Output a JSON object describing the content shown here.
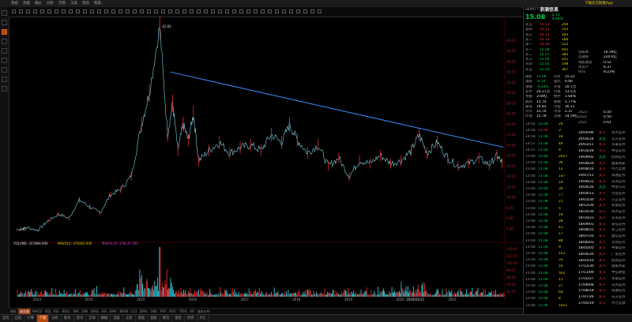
{
  "app": {
    "stock_code": "000977",
    "stock_name": "浪潮信息",
    "last_price": "15.08",
    "change": "-0.70",
    "change_pct": "-4.44%",
    "mode_label": "日线",
    "promo": "下载东方财富App",
    "colors": {
      "up": "#ff3b3b",
      "down": "#00d24c",
      "trend": "#3a8dff",
      "accent": "#b5470f",
      "volume": "#32c8d8"
    }
  },
  "menus": [
    "系统",
    "功能",
    "报价",
    "分析",
    "交易",
    "工具",
    "资讯",
    "帮助"
  ],
  "left_icons": [
    "home-icon",
    "quote-icon",
    "chart-icon",
    "news-icon",
    "trade-icon",
    "select-icon",
    "data-icon",
    "tool-icon",
    "more-icon"
  ],
  "chart_data": {
    "type": "line",
    "annotations": {
      "high_label": "42.83",
      "low_label": "3.65"
    },
    "y_ticks": [
      40,
      38,
      36,
      34,
      32,
      30,
      28,
      26,
      24,
      22,
      20,
      18,
      16,
      14,
      12,
      10,
      8,
      6,
      4
    ],
    "x_ticks": [
      "2013",
      "2014",
      "2015",
      "2016",
      "2017",
      "2018",
      "2019",
      "2020",
      "2020/03/11",
      "2021"
    ],
    "price_series": [
      {
        "x": 2012.6,
        "y": 3.8
      },
      {
        "x": 2012.8,
        "y": 4.2
      },
      {
        "x": 2013.0,
        "y": 3.7
      },
      {
        "x": 2013.2,
        "y": 5.5
      },
      {
        "x": 2013.4,
        "y": 6.8
      },
      {
        "x": 2013.6,
        "y": 6.0
      },
      {
        "x": 2013.8,
        "y": 9.5
      },
      {
        "x": 2014.0,
        "y": 8.2
      },
      {
        "x": 2014.2,
        "y": 7.0
      },
      {
        "x": 2014.4,
        "y": 10.5
      },
      {
        "x": 2014.6,
        "y": 11.5
      },
      {
        "x": 2014.8,
        "y": 14.0
      },
      {
        "x": 2015.0,
        "y": 24.0
      },
      {
        "x": 2015.15,
        "y": 30.0
      },
      {
        "x": 2015.35,
        "y": 42.8
      },
      {
        "x": 2015.5,
        "y": 22.0
      },
      {
        "x": 2015.6,
        "y": 28.0
      },
      {
        "x": 2015.7,
        "y": 19.0
      },
      {
        "x": 2015.8,
        "y": 24.0
      },
      {
        "x": 2015.9,
        "y": 21.0
      },
      {
        "x": 2016.0,
        "y": 26.0
      },
      {
        "x": 2016.1,
        "y": 17.0
      },
      {
        "x": 2016.3,
        "y": 19.0
      },
      {
        "x": 2016.5,
        "y": 20.5
      },
      {
        "x": 2016.7,
        "y": 18.5
      },
      {
        "x": 2016.9,
        "y": 19.5
      },
      {
        "x": 2017.1,
        "y": 20.0
      },
      {
        "x": 2017.3,
        "y": 19.0
      },
      {
        "x": 2017.5,
        "y": 22.0
      },
      {
        "x": 2017.7,
        "y": 20.5
      },
      {
        "x": 2017.85,
        "y": 24.0
      },
      {
        "x": 2018.0,
        "y": 21.0
      },
      {
        "x": 2018.2,
        "y": 18.5
      },
      {
        "x": 2018.4,
        "y": 20.0
      },
      {
        "x": 2018.6,
        "y": 16.0
      },
      {
        "x": 2018.8,
        "y": 17.5
      },
      {
        "x": 2019.0,
        "y": 14.0
      },
      {
        "x": 2019.2,
        "y": 17.0
      },
      {
        "x": 2019.4,
        "y": 16.5
      },
      {
        "x": 2019.6,
        "y": 18.0
      },
      {
        "x": 2019.8,
        "y": 16.5
      },
      {
        "x": 2020.0,
        "y": 17.0
      },
      {
        "x": 2020.2,
        "y": 19.0
      },
      {
        "x": 2020.35,
        "y": 22.0
      },
      {
        "x": 2020.5,
        "y": 18.5
      },
      {
        "x": 2020.7,
        "y": 20.5
      },
      {
        "x": 2020.9,
        "y": 17.5
      },
      {
        "x": 2021.1,
        "y": 16.0
      },
      {
        "x": 2021.3,
        "y": 16.5
      },
      {
        "x": 2021.5,
        "y": 17.5
      },
      {
        "x": 2021.7,
        "y": 16.2
      },
      {
        "x": 2021.85,
        "y": 18.0
      },
      {
        "x": 2021.95,
        "y": 16.5
      }
    ],
    "trend_line": {
      "from": {
        "x": 2015.55,
        "y": 34.0
      },
      "to": {
        "x": 2021.97,
        "y": 19.6
      }
    },
    "volume_labels": [
      "150.00",
      "120.00",
      "100.00",
      "80.00",
      "60.00",
      "40.00",
      "20.00"
    ],
    "volume_header": [
      "VOLUME: 247889.000",
      "MAVOL5: 379362.000",
      "MAVOL10: 378137.000"
    ],
    "ma_header": "MA5  MA10  MA20",
    "grid": false
  },
  "indicator_tabs": [
    "指标",
    "成交量",
    "MACD",
    "KDJ",
    "RSI",
    "BOLL",
    "WR",
    "DMI",
    "BIAS",
    "ASI",
    "EMV",
    "BRAR",
    "CCI",
    "DMA",
    "OBV",
    "PSY",
    "ROC",
    "TRIX",
    "VR",
    "成本分布"
  ],
  "bottom_tabs": [
    "首页",
    "自选",
    "行情",
    "个股",
    "分析",
    "板块",
    "资讯",
    "全球",
    "数据",
    "选股",
    "交易",
    "港股",
    "美股",
    "期货",
    "基金",
    "债券",
    "外汇"
  ],
  "quote_rows": [
    {
      "label": "卖五",
      "price": "15.13",
      "vol": "200",
      "color": "red"
    },
    {
      "label": "卖四",
      "price": "15.12",
      "vol": "252",
      "color": "red"
    },
    {
      "label": "卖三",
      "price": "15.11",
      "vol": "183",
      "color": "red"
    },
    {
      "label": "卖二",
      "price": "15.10",
      "vol": "166",
      "color": "red"
    },
    {
      "label": "卖一",
      "price": "15.09",
      "vol": "523",
      "color": "red"
    },
    {
      "label": "买一",
      "price": "15.08",
      "vol": "491",
      "color": "green"
    },
    {
      "label": "买二",
      "price": "15.07",
      "vol": "385",
      "color": "green"
    },
    {
      "label": "买三",
      "price": "15.06",
      "vol": "241",
      "color": "green"
    },
    {
      "label": "买四",
      "price": "15.05",
      "vol": "198",
      "color": "green"
    },
    {
      "label": "买五",
      "price": "15.04",
      "vol": "367",
      "color": "green"
    }
  ],
  "stats": [
    {
      "k": "最新",
      "v": "15.08",
      "k2": "均价",
      "v2": "15.22"
    },
    {
      "k": "涨跌",
      "v": "-0.70",
      "k2": "量比",
      "v2": "0.66"
    },
    {
      "k": "涨幅",
      "v": "-4.44%",
      "k2": "外盘",
      "v2": "10.7万"
    },
    {
      "k": "总手",
      "v": "24.27万",
      "k2": "内盘",
      "v2": "13.5万"
    },
    {
      "k": "金额",
      "v": "3.69亿",
      "k2": "换手",
      "v2": "1.64%"
    },
    {
      "k": "最高",
      "v": "15.74",
      "k2": "振幅",
      "v2": "5.77%"
    },
    {
      "k": "最低",
      "v": "14.83",
      "k2": "市盈",
      "v2": "26.11"
    },
    {
      "k": "今开",
      "v": "15.70",
      "k2": "市净",
      "v2": "2.37"
    },
    {
      "k": "昨收",
      "v": "15.78",
      "k2": "流通",
      "v2": "14.59亿"
    }
  ],
  "info_box": [
    {
      "k": "总股本",
      "v": "14.59亿"
    },
    {
      "k": "流通值",
      "v": "220.0亿"
    },
    {
      "k": "每股收益",
      "v": "0.52"
    },
    {
      "k": "净资产",
      "v": "6.37"
    },
    {
      "k": "ROE",
      "v": "8.23%"
    }
  ],
  "ticks": [
    {
      "t": "14:55",
      "p": "15.08",
      "v": "24",
      "c": "green"
    },
    {
      "t": "14:56",
      "p": "15.09",
      "v": "3",
      "c": "red"
    },
    {
      "t": "14:56",
      "p": "15.08",
      "v": "18",
      "c": "green"
    },
    {
      "t": "14:57",
      "p": "15.08",
      "v": "49",
      "c": "green"
    },
    {
      "t": "14:57",
      "p": "15.08",
      "v": "9",
      "c": "green"
    },
    {
      "t": "15:00",
      "p": "15.08",
      "v": "2457",
      "c": "green"
    },
    {
      "t": "15:00",
      "p": "15.08",
      "v": "36",
      "c": "green"
    },
    {
      "t": "15:00",
      "p": "15.08",
      "v": "12",
      "c": "green"
    },
    {
      "t": "15:00",
      "p": "15.08",
      "v": "107",
      "c": "green"
    },
    {
      "t": "15:00",
      "p": "15.08",
      "v": "14",
      "c": "green"
    },
    {
      "t": "15:00",
      "p": "15.08",
      "v": "30",
      "c": "green"
    },
    {
      "t": "15:00",
      "p": "15.08",
      "v": "77",
      "c": "green"
    },
    {
      "t": "15:00",
      "p": "15.08",
      "v": "21",
      "c": "green"
    },
    {
      "t": "15:00",
      "p": "15.08",
      "v": "5",
      "c": "green"
    },
    {
      "t": "15:00",
      "p": "15.08",
      "v": "19",
      "c": "green"
    },
    {
      "t": "15:00",
      "p": "15.08",
      "v": "28",
      "c": "green"
    },
    {
      "t": "15:00",
      "p": "15.08",
      "v": "41",
      "c": "green"
    },
    {
      "t": "15:00",
      "p": "15.08",
      "v": "17",
      "c": "green"
    },
    {
      "t": "15:00",
      "p": "15.08",
      "v": "88",
      "c": "green"
    },
    {
      "t": "15:00",
      "p": "15.08",
      "v": "9",
      "c": "green"
    },
    {
      "t": "15:00",
      "p": "15.08",
      "v": "152",
      "c": "green"
    },
    {
      "t": "15:00",
      "p": "15.08",
      "v": "33",
      "c": "green"
    },
    {
      "t": "15:00",
      "p": "15.08",
      "v": "16",
      "c": "green"
    },
    {
      "t": "15:00",
      "p": "15.08",
      "v": "502",
      "c": "green"
    },
    {
      "t": "15:00",
      "p": "15.08",
      "v": "11",
      "c": "green"
    },
    {
      "t": "15:00",
      "p": "15.08",
      "v": "27",
      "c": "green"
    },
    {
      "t": "15:00",
      "p": "15.08",
      "v": "64",
      "c": "green"
    },
    {
      "t": "15:00",
      "p": "15.08",
      "v": "8",
      "c": "green"
    },
    {
      "t": "15:00",
      "p": "15.08",
      "v": "1021",
      "c": "green"
    }
  ],
  "events": [
    {
      "d": "20/05/06",
      "a": "买入",
      "b": "光大证券"
    },
    {
      "d": "20/04/24",
      "a": "卖出",
      "b": "东方证券"
    },
    {
      "d": "20/03/11",
      "a": "买入",
      "b": "华泰证券"
    },
    {
      "d": "19/10/28",
      "a": "买入",
      "b": "中信证券"
    },
    {
      "d": "19/09/02",
      "a": "卖出",
      "b": "招商证券"
    },
    {
      "d": "19/08/29",
      "a": "买入",
      "b": "国泰君安"
    },
    {
      "d": "19/08/16",
      "a": "买入",
      "b": "申万宏源"
    },
    {
      "d": "19/07/11",
      "a": "买入",
      "b": "海通证券"
    },
    {
      "d": "19/06/22",
      "a": "买入",
      "b": "天风证券"
    },
    {
      "d": "19/04/26",
      "a": "卖出",
      "b": "中金公司"
    },
    {
      "d": "19/04/12",
      "a": "买入",
      "b": "兴业证券"
    },
    {
      "d": "19/03/30",
      "a": "买入",
      "b": "方正证券"
    },
    {
      "d": "18/12/26",
      "a": "买入",
      "b": "长城证券"
    },
    {
      "d": "18/10/30",
      "a": "买入",
      "b": "光大证券"
    },
    {
      "d": "18/10/23",
      "a": "买入",
      "b": "东吴证券"
    },
    {
      "d": "18/09/01",
      "a": "买入",
      "b": "安信证券"
    },
    {
      "d": "18/08/25",
      "a": "买入",
      "b": "长江证券"
    },
    {
      "d": "18/07/20",
      "a": "买入",
      "b": "国信证券"
    },
    {
      "d": "18/06/03",
      "a": "买入",
      "b": "华创证券"
    },
    {
      "d": "18/05/05",
      "a": "买入",
      "b": "中泰证券"
    },
    {
      "d": "18/04/26",
      "a": "买入",
      "b": "广发证券"
    },
    {
      "d": "18/03/10",
      "a": "买入",
      "b": "招商证券"
    },
    {
      "d": "17/12/30",
      "a": "买入",
      "b": "国泰君安"
    },
    {
      "d": "17/11/09",
      "a": "买入",
      "b": "中信建投"
    },
    {
      "d": "17/10/27",
      "a": "买入",
      "b": "华泰证券"
    },
    {
      "d": "17/09/08",
      "a": "买入",
      "b": "天风证券"
    },
    {
      "d": "17/08/18",
      "a": "买入",
      "b": "海通证券"
    },
    {
      "d": "17/07/26",
      "a": "买入",
      "b": "东方证券"
    },
    {
      "d": "17/05/19",
      "a": "买入",
      "b": "申万宏源"
    }
  ],
  "year_summary": [
    {
      "y": "2023",
      "v": "0.50"
    },
    {
      "y": "2022",
      "v": "0.50"
    },
    {
      "y": "2021",
      "v": "0.61"
    }
  ]
}
